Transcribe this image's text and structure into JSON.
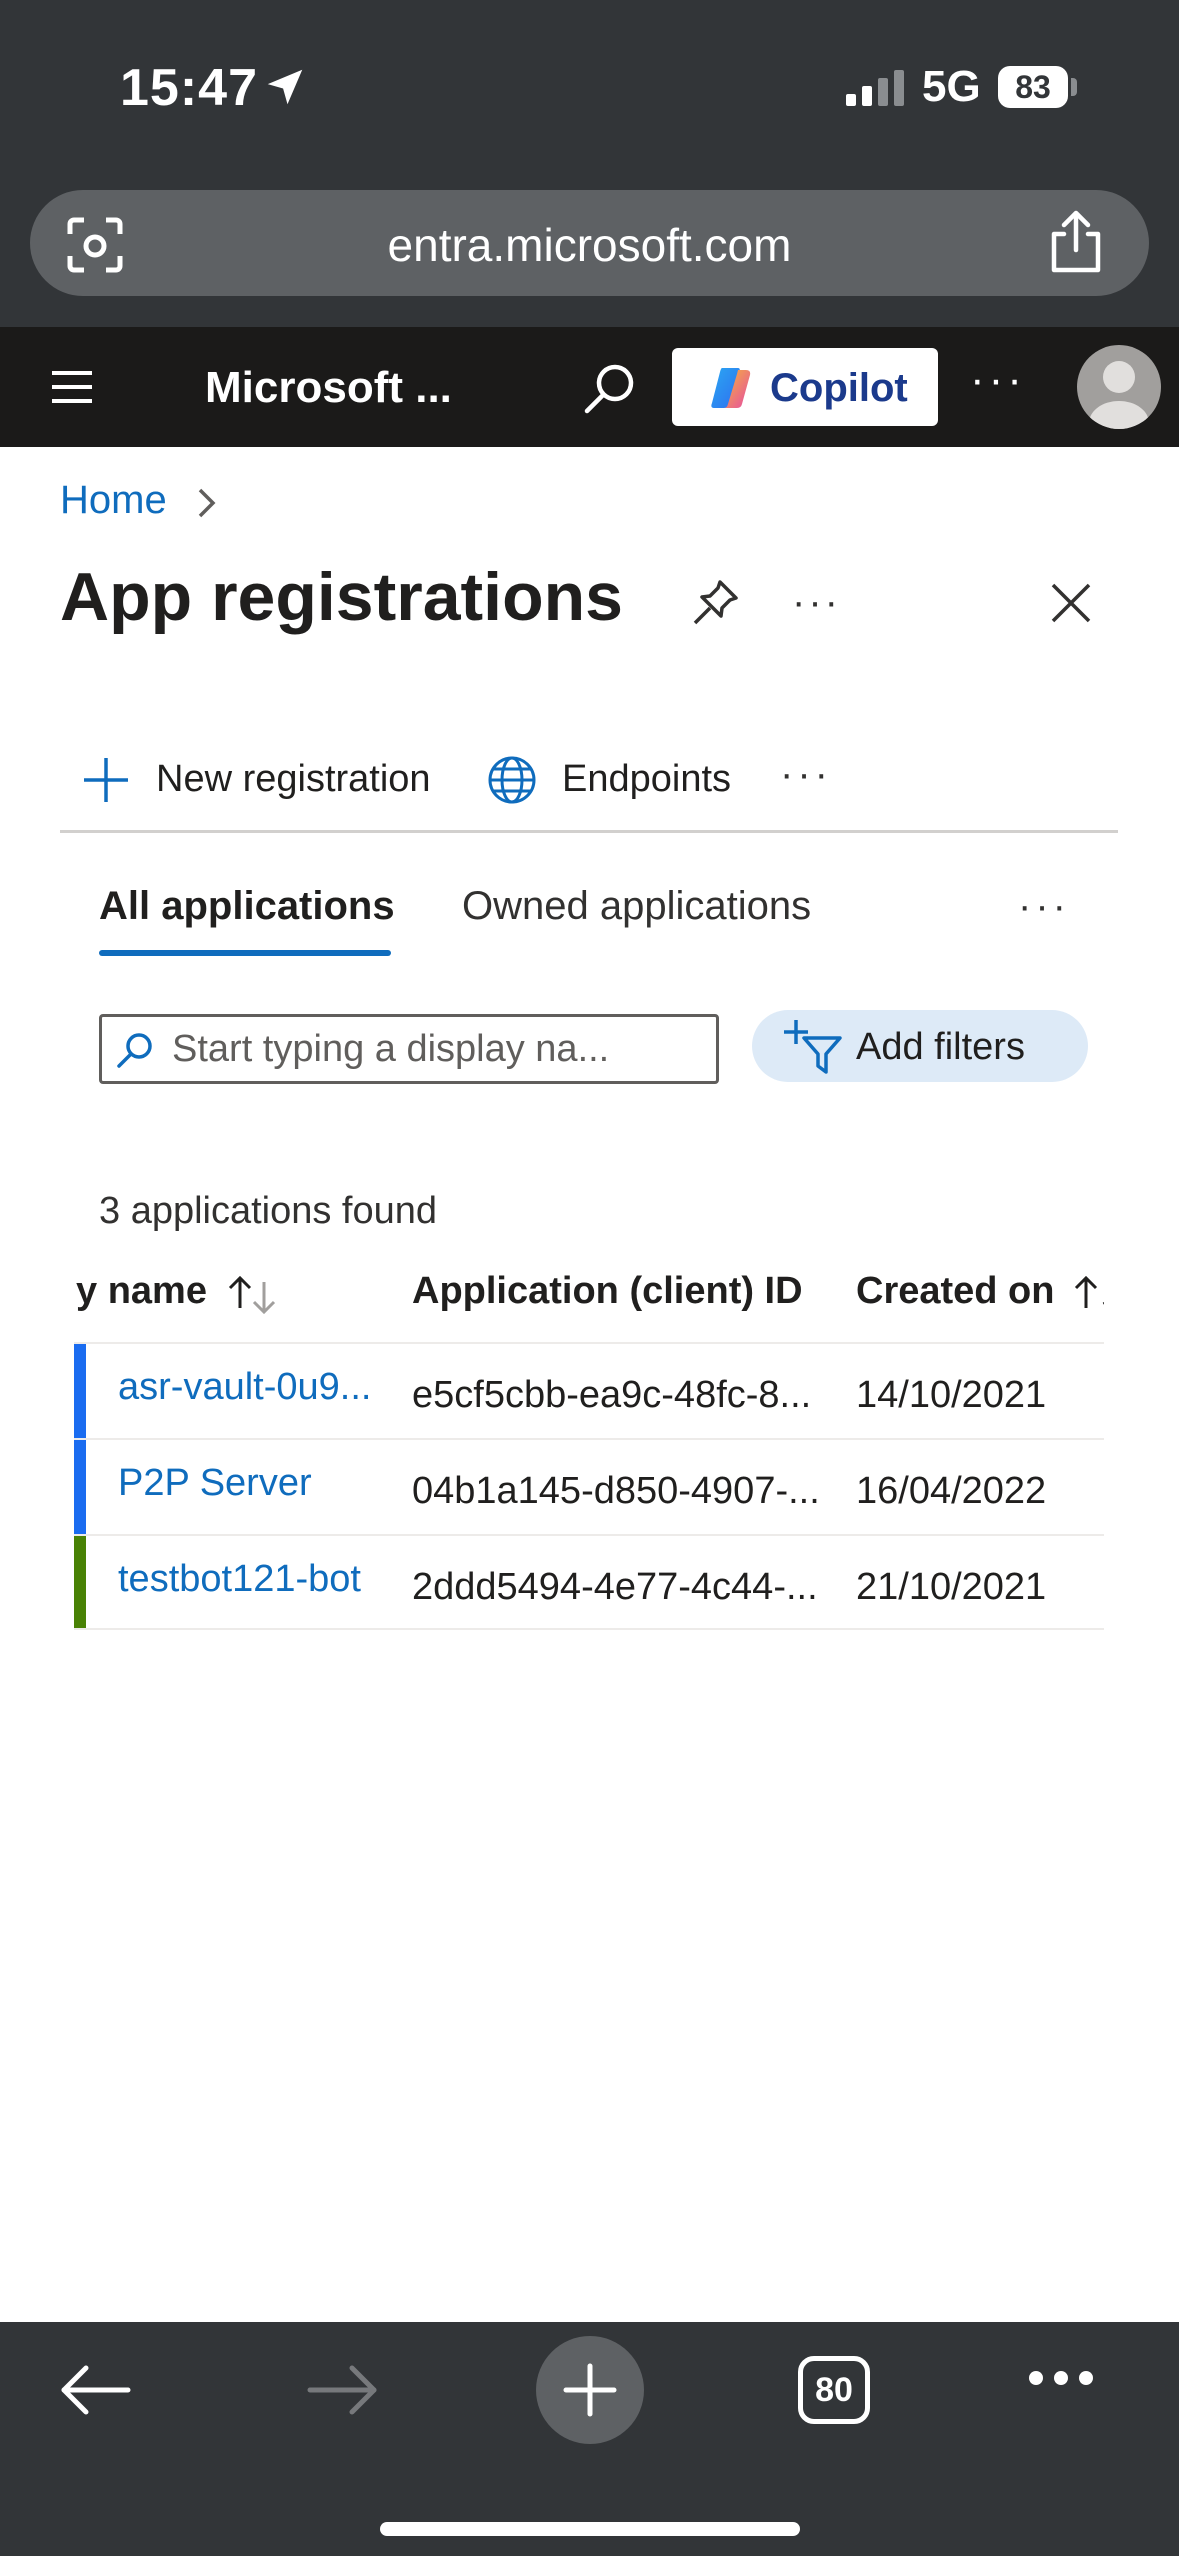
{
  "status_bar": {
    "time": "15:47",
    "network": "5G",
    "battery": "83"
  },
  "browser": {
    "url": "entra.microsoft.com",
    "open_tabs": "80"
  },
  "header": {
    "brand": "Microsoft ...",
    "copilot_label": "Copilot",
    "more": "···"
  },
  "breadcrumb": {
    "home": "Home"
  },
  "page": {
    "title": "App registrations",
    "more": "···"
  },
  "toolbar": {
    "new_registration": "New registration",
    "endpoints": "Endpoints",
    "more": "···"
  },
  "tabs": {
    "all": "All applications",
    "owned": "Owned applications",
    "more": "···"
  },
  "search": {
    "placeholder": "Start typing a display na..."
  },
  "filters": {
    "label": "Add filters"
  },
  "results": {
    "count_text": "3 applications found"
  },
  "table": {
    "headers": {
      "name": "y name",
      "id": "Application (client) ID",
      "created": "Created on"
    },
    "rows": [
      {
        "name": "asr-vault-0u9...",
        "id": "e5cf5cbb-ea9c-48fc-8...",
        "created": "14/10/2021",
        "bar_color": "#1a6cf0"
      },
      {
        "name": "P2P Server",
        "id": "04b1a145-d850-4907-...",
        "created": "16/04/2022",
        "bar_color": "#1a6cf0"
      },
      {
        "name": "testbot121-bot",
        "id": "2ddd5494-4e77-4c44-...",
        "created": "21/10/2021",
        "bar_color": "#498205"
      }
    ]
  },
  "colors": {
    "link": "#0f6cbd",
    "header_bg": "#1b1a19",
    "browser_chrome": "#323538"
  }
}
